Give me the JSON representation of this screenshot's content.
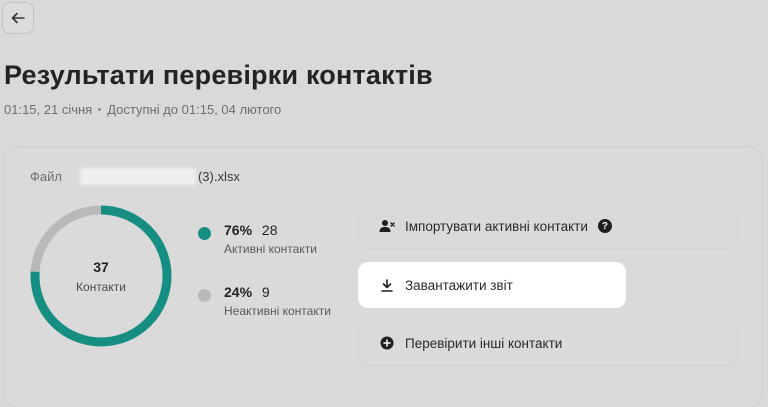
{
  "header": {
    "title": "Результати перевірки контактів",
    "created": "01:15, 21 січня",
    "available": "Доступні до 01:15, 04 лютого"
  },
  "file": {
    "label": "Файл",
    "name_suffix": "(3).xlsx"
  },
  "summary": {
    "total": "37",
    "total_label": "Контакти",
    "active": {
      "percent": "76%",
      "count": "28",
      "label": "Активні контакти",
      "fraction": 0.76,
      "color": "#168f82"
    },
    "inactive": {
      "percent": "24%",
      "count": "9",
      "label": "Неактивні контакти",
      "fraction": 0.24,
      "color": "#b9b9b9"
    }
  },
  "actions": {
    "import_label": "Імпортувати активні контакти",
    "download_label": "Завантажити звіт",
    "check_label": "Перевірити інші контакти"
  },
  "icons": {
    "back": "arrow-left-icon",
    "import": "user-plus-icon",
    "help": "question-circle-icon",
    "download": "download-icon",
    "check": "plus-circle-icon"
  }
}
